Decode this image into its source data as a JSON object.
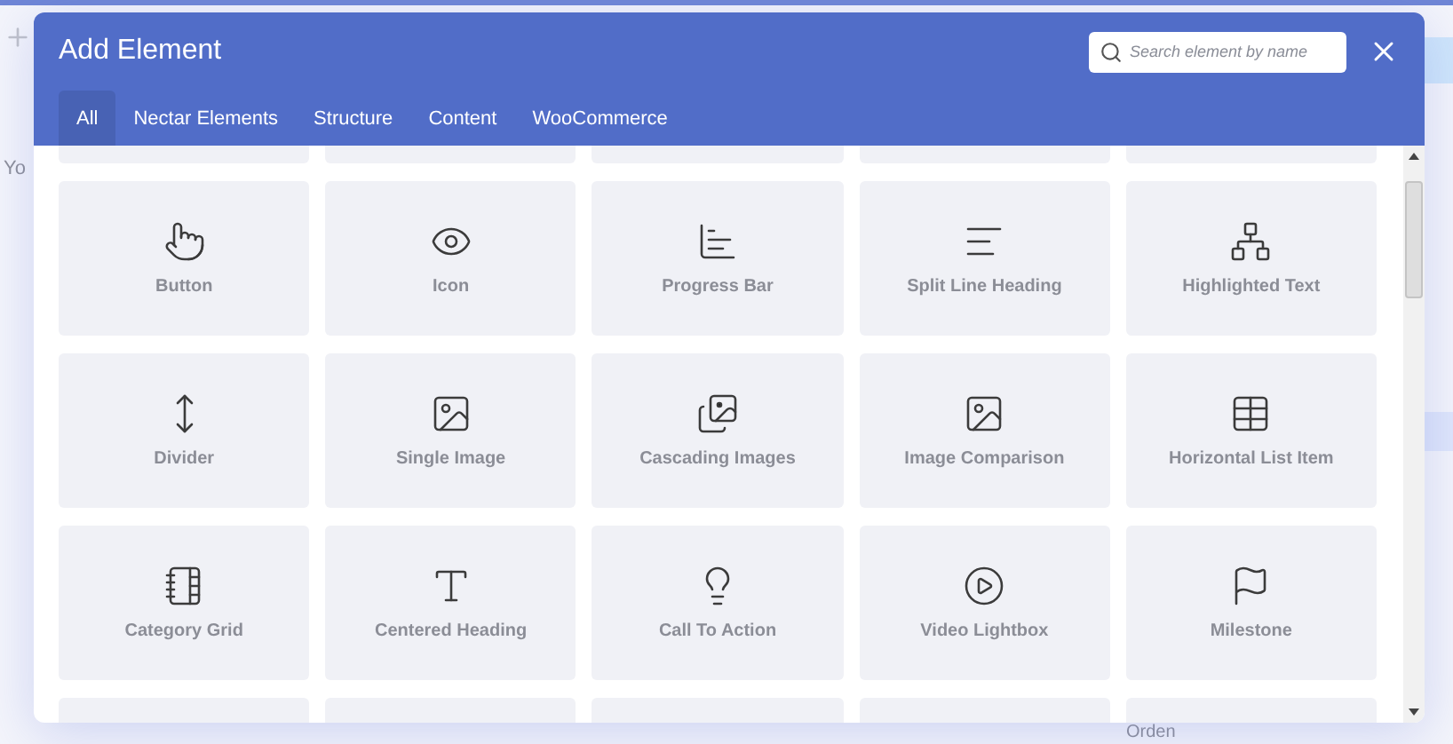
{
  "background": {
    "left_label": "Yo",
    "bottom_label": "Orden"
  },
  "modal": {
    "title": "Add Element",
    "search": {
      "placeholder": "Search element by name"
    },
    "tabs": [
      {
        "label": "All",
        "selected": true
      },
      {
        "label": "Nectar Elements",
        "selected": false
      },
      {
        "label": "Structure",
        "selected": false
      },
      {
        "label": "Content",
        "selected": false
      },
      {
        "label": "WooCommerce",
        "selected": false
      }
    ],
    "elements": [
      {
        "label": "Button",
        "kind": "hand"
      },
      {
        "label": "Icon",
        "kind": "eye"
      },
      {
        "label": "Progress Bar",
        "kind": "bars"
      },
      {
        "label": "Split Line Heading",
        "kind": "lines"
      },
      {
        "label": "Highlighted Text",
        "kind": "tree"
      },
      {
        "label": "Divider",
        "kind": "divider"
      },
      {
        "label": "Single Image",
        "kind": "image"
      },
      {
        "label": "Cascading Images",
        "kind": "images"
      },
      {
        "label": "Image Comparison",
        "kind": "image"
      },
      {
        "label": "Horizontal List Item",
        "kind": "list"
      },
      {
        "label": "Category Grid",
        "kind": "notebook"
      },
      {
        "label": "Centered Heading",
        "kind": "heading"
      },
      {
        "label": "Call To Action",
        "kind": "bulb"
      },
      {
        "label": "Video Lightbox",
        "kind": "play"
      },
      {
        "label": "Milestone",
        "kind": "flag"
      }
    ]
  }
}
